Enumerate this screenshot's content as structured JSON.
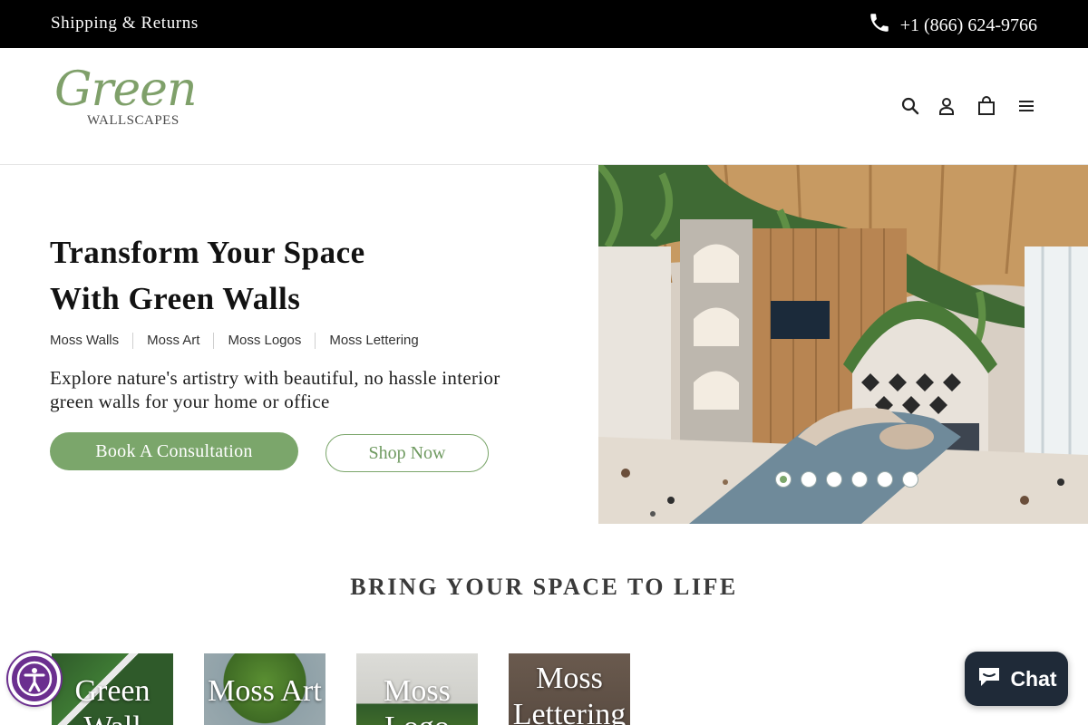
{
  "topbar": {
    "shipping_link": "Shipping & Returns",
    "phone": "+1 (866) 624-9766",
    "phone_icon": "phone-icon"
  },
  "header": {
    "logo_script": "Green",
    "logo_sub": "WALLSCAPES",
    "icons": [
      "search-icon",
      "account-icon",
      "cart-icon",
      "menu-icon"
    ]
  },
  "hero": {
    "title_line1": "Transform Your Space",
    "title_line2": "With Green Walls",
    "categories": [
      "Moss Walls",
      "Moss Art",
      "Moss Logos",
      "Moss Lettering"
    ],
    "description": "Explore nature's artistry with beautiful, no hassle interior green walls for your home or office",
    "primary_button": "Book A Consultation",
    "secondary_button": "Shop Now",
    "slide_count": 6,
    "active_slide": 1
  },
  "section": {
    "title": "BRING YOUR SPACE TO LIFE",
    "cards": [
      {
        "label": "Green Wall"
      },
      {
        "label": "Moss Art"
      },
      {
        "label": "Moss Logo"
      },
      {
        "label": "Moss Lettering"
      }
    ]
  },
  "widgets": {
    "accessibility_icon": "accessibility-icon",
    "chat_label": "Chat",
    "chat_icon": "chat-bubble-icon"
  },
  "colors": {
    "brand_green": "#7ba66b",
    "topbar_bg": "#000000",
    "chat_bg": "#1f2a38",
    "a11y_purple": "#6b2f8f"
  }
}
